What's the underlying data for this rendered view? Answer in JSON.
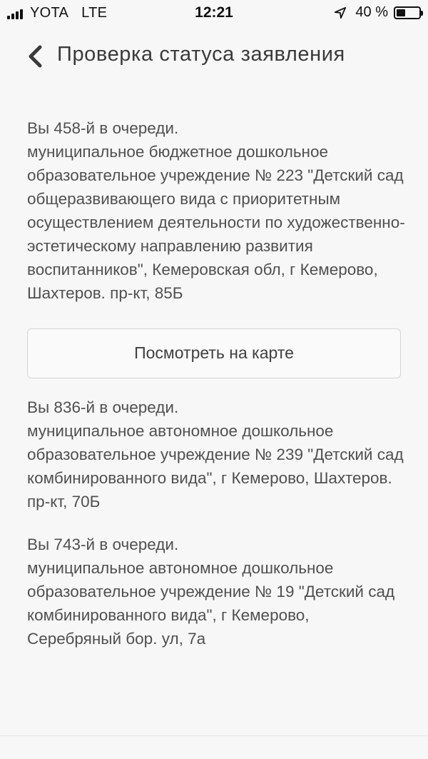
{
  "status_bar": {
    "carrier": "YOTA",
    "network": "LTE",
    "time": "12:21",
    "battery_percent": "40 %",
    "battery_level": 0.4
  },
  "nav": {
    "title": "Проверка статуса заявления"
  },
  "entries": [
    {
      "position": "Вы 458-й в очереди.",
      "institution": "муниципальное бюджетное дошкольное образовательное учреждение № 223 \"Детский сад общеразвивающего вида с приоритетным осуществлением деятельности по художественно-эстетическому направлению развития воспитанников\", Кемеровская обл, г Кемерово, Шахтеров. пр-кт, 85Б"
    },
    {
      "position": "Вы 836-й в очереди.",
      "institution": "муниципальное автономное дошкольное образовательное учреждение № 239 \"Детский сад комбинированного вида\", г Кемерово, Шахтеров. пр-кт, 70Б"
    },
    {
      "position": "Вы 743-й в очереди.",
      "institution": "муниципальное автономное дошкольное образовательное учреждение № 19 \"Детский сад комбинированного вида\", г Кемерово, Серебряный бор. ул, 7а"
    }
  ],
  "map_button": {
    "label": "Посмотреть на карте"
  },
  "icons": {
    "signal": "signal-bars-icon",
    "location": "location-arrow-icon",
    "battery": "battery-icon",
    "back": "chevron-left-icon"
  }
}
